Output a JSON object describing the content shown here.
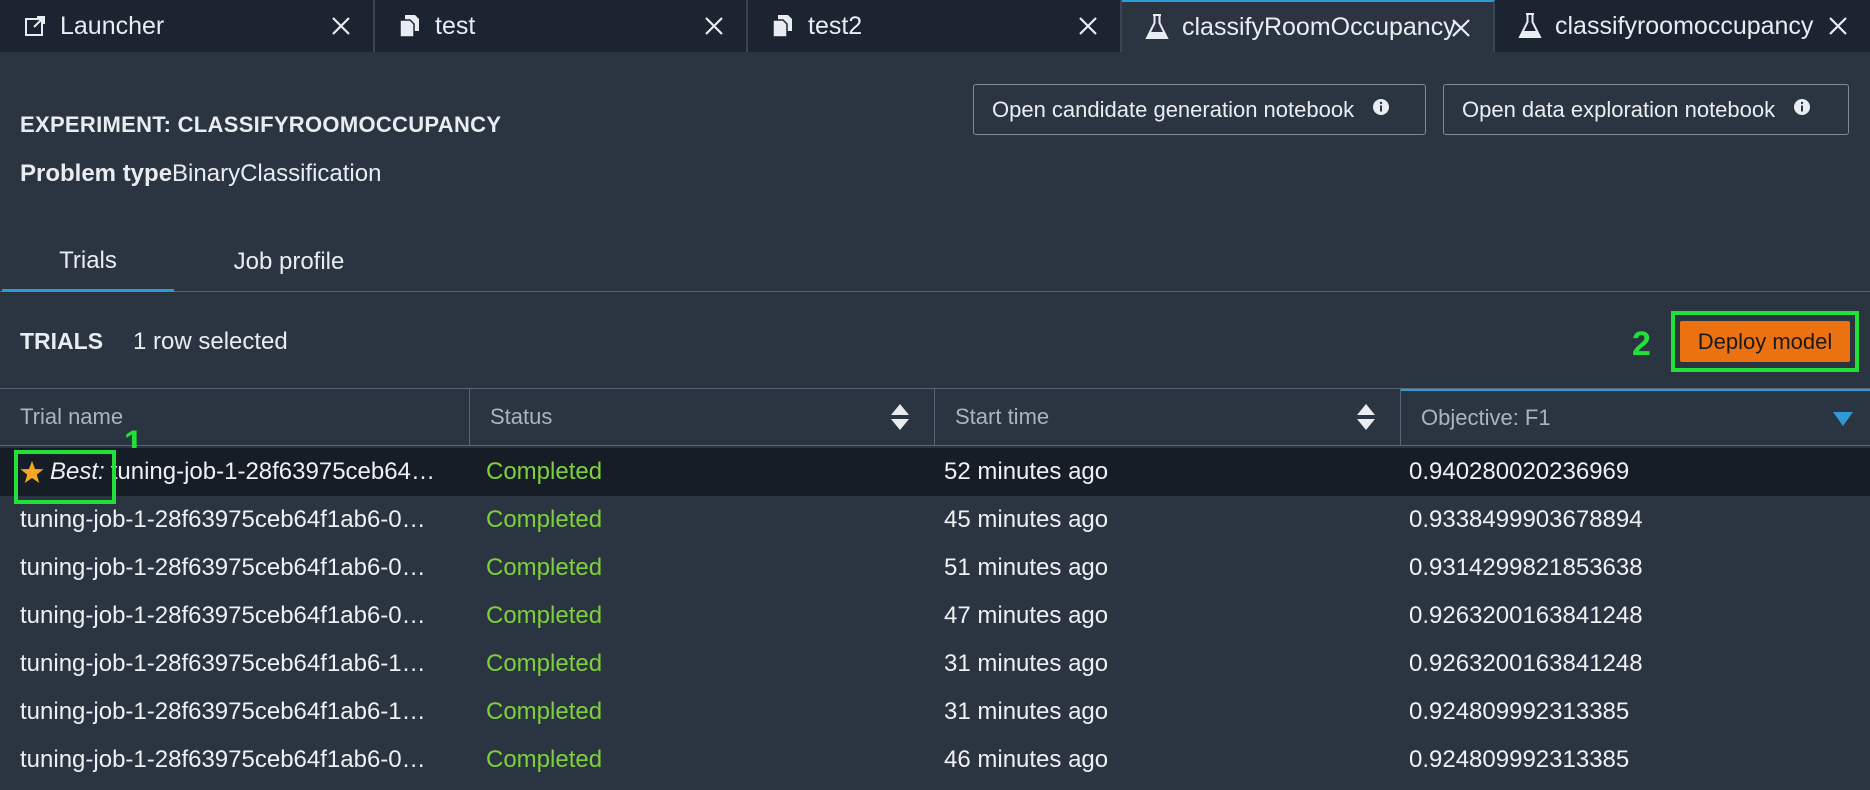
{
  "tabs": [
    {
      "label": "Launcher",
      "icon": "launcher-icon"
    },
    {
      "label": "test",
      "icon": "notebook-icon"
    },
    {
      "label": "test2",
      "icon": "notebook-icon"
    },
    {
      "label": "classifyRoomOccupancy",
      "icon": "flask-icon",
      "active": true
    },
    {
      "label": "classifyroomoccupancy",
      "icon": "flask-icon"
    }
  ],
  "experiment": {
    "title": "EXPERIMENT: CLASSIFYROOMOCCUPANCY",
    "problem_type_label": "Problem type",
    "problem_type_value": "BinaryClassification"
  },
  "buttons": {
    "candidate_nb": "Open candidate generation notebook",
    "data_nb": "Open data exploration notebook",
    "deploy": "Deploy model"
  },
  "subtabs": [
    "Trials",
    "Job profile"
  ],
  "trials": {
    "title": "TRIALS",
    "selection": "1 row selected"
  },
  "markers": {
    "one": "1",
    "two": "2"
  },
  "table": {
    "columns": [
      "Trial name",
      "Status",
      "Start time",
      "Objective: F1"
    ],
    "best_label": "Best:",
    "rows": [
      {
        "name": "tuning-job-1-28f63975ceb64…",
        "status": "Completed",
        "start": "52 minutes ago",
        "objective": "0.940280020236969"
      },
      {
        "name": "tuning-job-1-28f63975ceb64f1ab6-0…",
        "status": "Completed",
        "start": "45 minutes ago",
        "objective": "0.9338499903678894"
      },
      {
        "name": "tuning-job-1-28f63975ceb64f1ab6-0…",
        "status": "Completed",
        "start": "51 minutes ago",
        "objective": "0.9314299821853638"
      },
      {
        "name": "tuning-job-1-28f63975ceb64f1ab6-0…",
        "status": "Completed",
        "start": "47 minutes ago",
        "objective": "0.9263200163841248"
      },
      {
        "name": "tuning-job-1-28f63975ceb64f1ab6-1…",
        "status": "Completed",
        "start": "31 minutes ago",
        "objective": "0.9263200163841248"
      },
      {
        "name": "tuning-job-1-28f63975ceb64f1ab6-1…",
        "status": "Completed",
        "start": "31 minutes ago",
        "objective": "0.924809992313385"
      },
      {
        "name": "tuning-job-1-28f63975ceb64f1ab6-0…",
        "status": "Completed",
        "start": "46 minutes ago",
        "objective": "0.924809992313385"
      }
    ]
  },
  "colors": {
    "accent": "#2e9bd6",
    "deploy": "#ec7211",
    "status_completed": "#7ed03c",
    "highlight": "#22e03a"
  }
}
